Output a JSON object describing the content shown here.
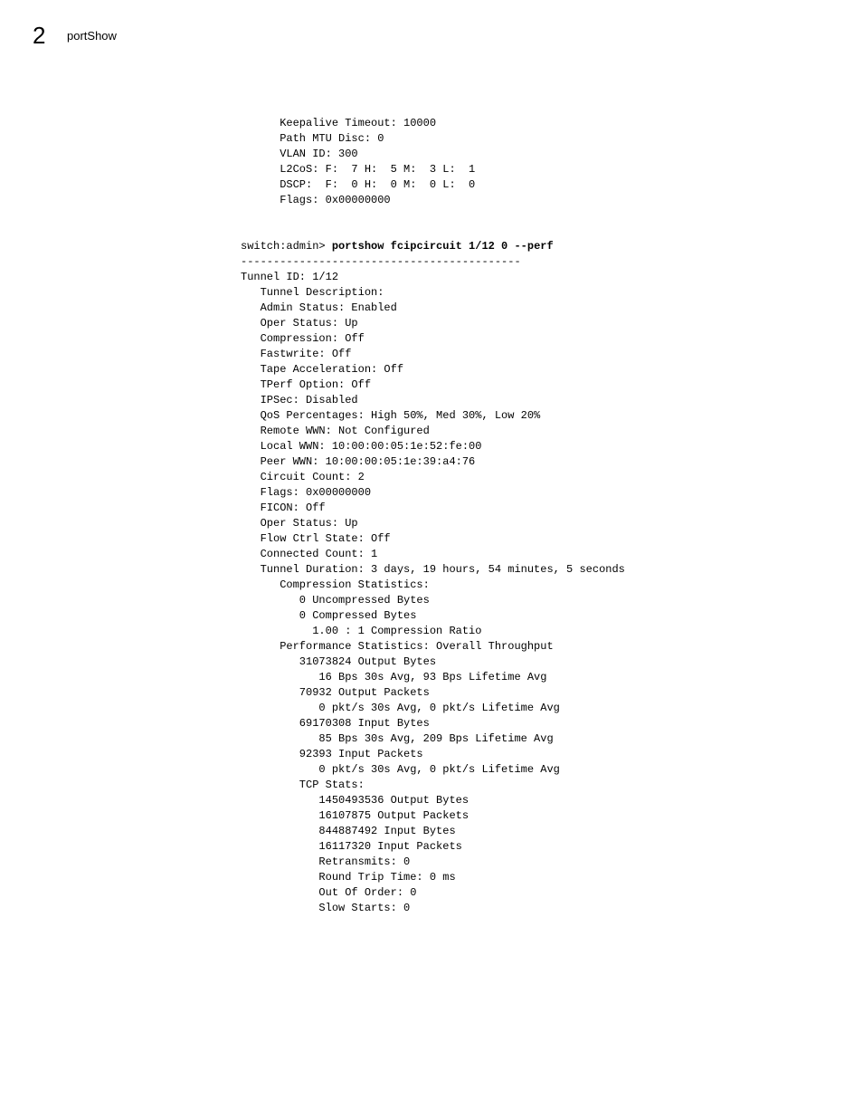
{
  "header": {
    "chapter_number": "2",
    "chapter_title": "portShow"
  },
  "terminal": {
    "block1": "      Keepalive Timeout: 10000\n      Path MTU Disc: 0\n      VLAN ID: 300\n      L2CoS: F:  7 H:  5 M:  3 L:  1\n      DSCP:  F:  0 H:  0 M:  0 L:  0\n      Flags: 0x00000000\n\n\n",
    "cmdline_prefix": "switch:admin> ",
    "cmdline_cmd": "portshow fcipcircuit 1/12 0 --perf",
    "block2": "\n-------------------------------------------\nTunnel ID: 1/12\n   Tunnel Description:\n   Admin Status: Enabled\n   Oper Status: Up\n   Compression: Off\n   Fastwrite: Off\n   Tape Acceleration: Off\n   TPerf Option: Off\n   IPSec: Disabled\n   QoS Percentages: High 50%, Med 30%, Low 20%\n   Remote WWN: Not Configured\n   Local WWN: 10:00:00:05:1e:52:fe:00\n   Peer WWN: 10:00:00:05:1e:39:a4:76\n   Circuit Count: 2\n   Flags: 0x00000000\n   FICON: Off\n   Oper Status: Up\n   Flow Ctrl State: Off\n   Connected Count: 1\n   Tunnel Duration: 3 days, 19 hours, 54 minutes, 5 seconds\n      Compression Statistics:\n         0 Uncompressed Bytes\n         0 Compressed Bytes\n           1.00 : 1 Compression Ratio\n      Performance Statistics: Overall Throughput\n         31073824 Output Bytes\n            16 Bps 30s Avg, 93 Bps Lifetime Avg\n         70932 Output Packets\n            0 pkt/s 30s Avg, 0 pkt/s Lifetime Avg\n         69170308 Input Bytes\n            85 Bps 30s Avg, 209 Bps Lifetime Avg\n         92393 Input Packets\n            0 pkt/s 30s Avg, 0 pkt/s Lifetime Avg\n         TCP Stats:\n            1450493536 Output Bytes\n            16107875 Output Packets\n            844887492 Input Bytes\n            16117320 Input Packets\n            Retransmits: 0\n            Round Trip Time: 0 ms\n            Out Of Order: 0\n            Slow Starts: 0"
  }
}
